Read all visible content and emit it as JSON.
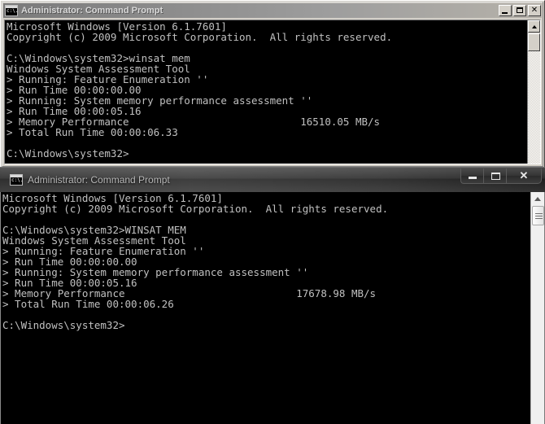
{
  "window1": {
    "title": "Administrator: Command Prompt",
    "icon": "cmd-icon",
    "style": "classic-inactive",
    "controls": {
      "minimize": "_",
      "maximize": "□",
      "close": "✕"
    },
    "console_lines": [
      "Microsoft Windows [Version 6.1.7601]",
      "Copyright (c) 2009 Microsoft Corporation.  All rights reserved.",
      "",
      "C:\\Windows\\system32>winsat mem",
      "Windows System Assessment Tool",
      "> Running: Feature Enumeration ''",
      "> Run Time 00:00:00.00",
      "> Running: System memory performance assessment ''",
      "> Run Time 00:00:05.16",
      "> Memory Performance                            16510.05 MB/s",
      "> Total Run Time 00:00:06.33",
      "",
      "C:\\Windows\\system32>"
    ],
    "command": "winsat mem",
    "memory_performance": "16510.05 MB/s",
    "total_run_time": "00:00:06.33",
    "prompt": "C:\\Windows\\system32>"
  },
  "window2": {
    "title": "Administrator: Command Prompt",
    "icon": "cmd-icon",
    "style": "aero-active",
    "controls": {
      "minimize": "_",
      "maximize": "□",
      "close": "✕"
    },
    "console_lines": [
      "Microsoft Windows [Version 6.1.7601]",
      "Copyright (c) 2009 Microsoft Corporation.  All rights reserved.",
      "",
      "C:\\Windows\\system32>WINSAT MEM",
      "Windows System Assessment Tool",
      "> Running: Feature Enumeration ''",
      "> Run Time 00:00:00.00",
      "> Running: System memory performance assessment ''",
      "> Run Time 00:00:05.16",
      "> Memory Performance                            17678.98 MB/s",
      "> Total Run Time 00:00:06.26",
      "",
      "C:\\Windows\\system32>"
    ],
    "command": "WINSAT MEM",
    "memory_performance": "17678.98 MB/s",
    "total_run_time": "00:00:06.26",
    "prompt": "C:\\Windows\\system32>"
  },
  "colors": {
    "console_bg": "#000000",
    "console_fg": "#c0c0c0",
    "classic_face": "#d4d0c8",
    "aero_glass": "#2e2e2e"
  }
}
